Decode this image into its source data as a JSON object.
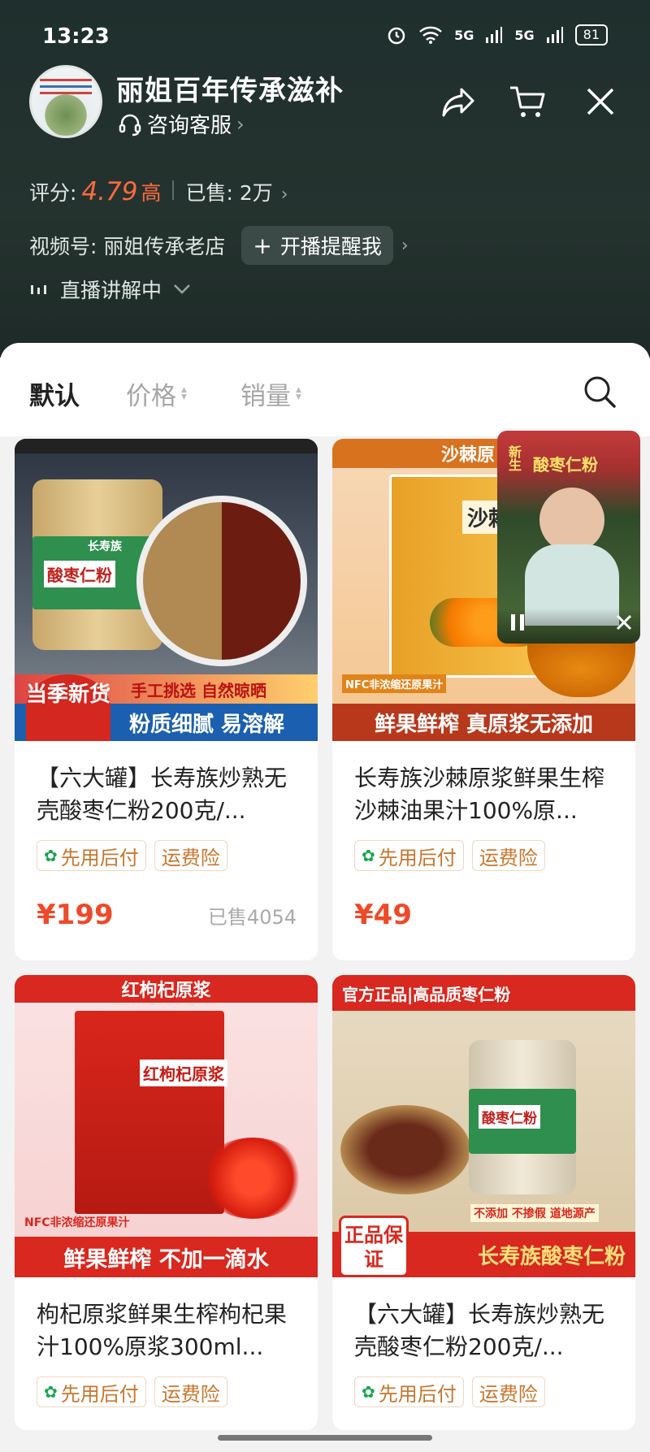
{
  "status": {
    "time": "13:23",
    "net1": "5G",
    "net2": "5G",
    "battery": "81"
  },
  "shop": {
    "name": "丽姐百年传承滋补",
    "consult": "咨询客服",
    "rating_label": "评分:",
    "rating_value": "4.79",
    "rating_level": "高",
    "sold_label": "已售: 2万",
    "video_account": "视频号: 丽姐传承老店",
    "remind_button": "开播提醒我",
    "live_status": "直播讲解中"
  },
  "sort": {
    "default": "默认",
    "price": "价格",
    "sales": "销量"
  },
  "products": [
    {
      "title": "【六大罐】长寿族炒熟无壳酸枣仁粉200克/...",
      "tags": [
        "先用后付",
        "运费险"
      ],
      "price": "¥199",
      "sold": "已售4054",
      "img_brand": "长寿族",
      "img_name": "酸枣仁粉",
      "img_line1": "手工挑选 自然晾晒",
      "img_line2": "粉质细腻 易溶解",
      "img_badge": "当季新货"
    },
    {
      "title": "长寿族沙棘原浆鲜果生榨沙棘油果汁100%原...",
      "tags": [
        "先用后付",
        "运费险"
      ],
      "price": "¥49",
      "sold": "",
      "img_top": "沙棘原",
      "img_name": "沙棘",
      "img_nfc": "NFC非浓缩还原果汁",
      "img_line": "鲜果鲜榨 真原浆无添加"
    },
    {
      "title": "枸杞原浆鲜果生榨枸杞果汁100%原浆300ml...",
      "tags": [
        "先用后付",
        "运费险"
      ],
      "price": "",
      "sold": "",
      "img_top": "红枸杞原浆",
      "img_name": "红枸杞原浆",
      "img_nfc": "NFC非浓缩还原果汁",
      "img_line": "鲜果鲜榨 不加一滴水"
    },
    {
      "title": "【六大罐】长寿族炒熟无壳酸枣仁粉200克/...",
      "tags": [
        "先用后付",
        "运费险"
      ],
      "price": "",
      "sold": "",
      "img_top": "官方正品|高品质枣仁粉",
      "img_name": "酸枣仁粉",
      "img_line": "长寿族酸枣仁粉",
      "img_badge": "正品保证",
      "img_small": "不添加 不掺假 道地源产"
    }
  ],
  "pip": {
    "title": "酸枣仁粉",
    "side": "新生"
  },
  "colors": {
    "accent": "#ee4a2a",
    "header_bg": "#22302d",
    "tag_text": "#c9772f",
    "tag_icon": "#19a64d"
  }
}
